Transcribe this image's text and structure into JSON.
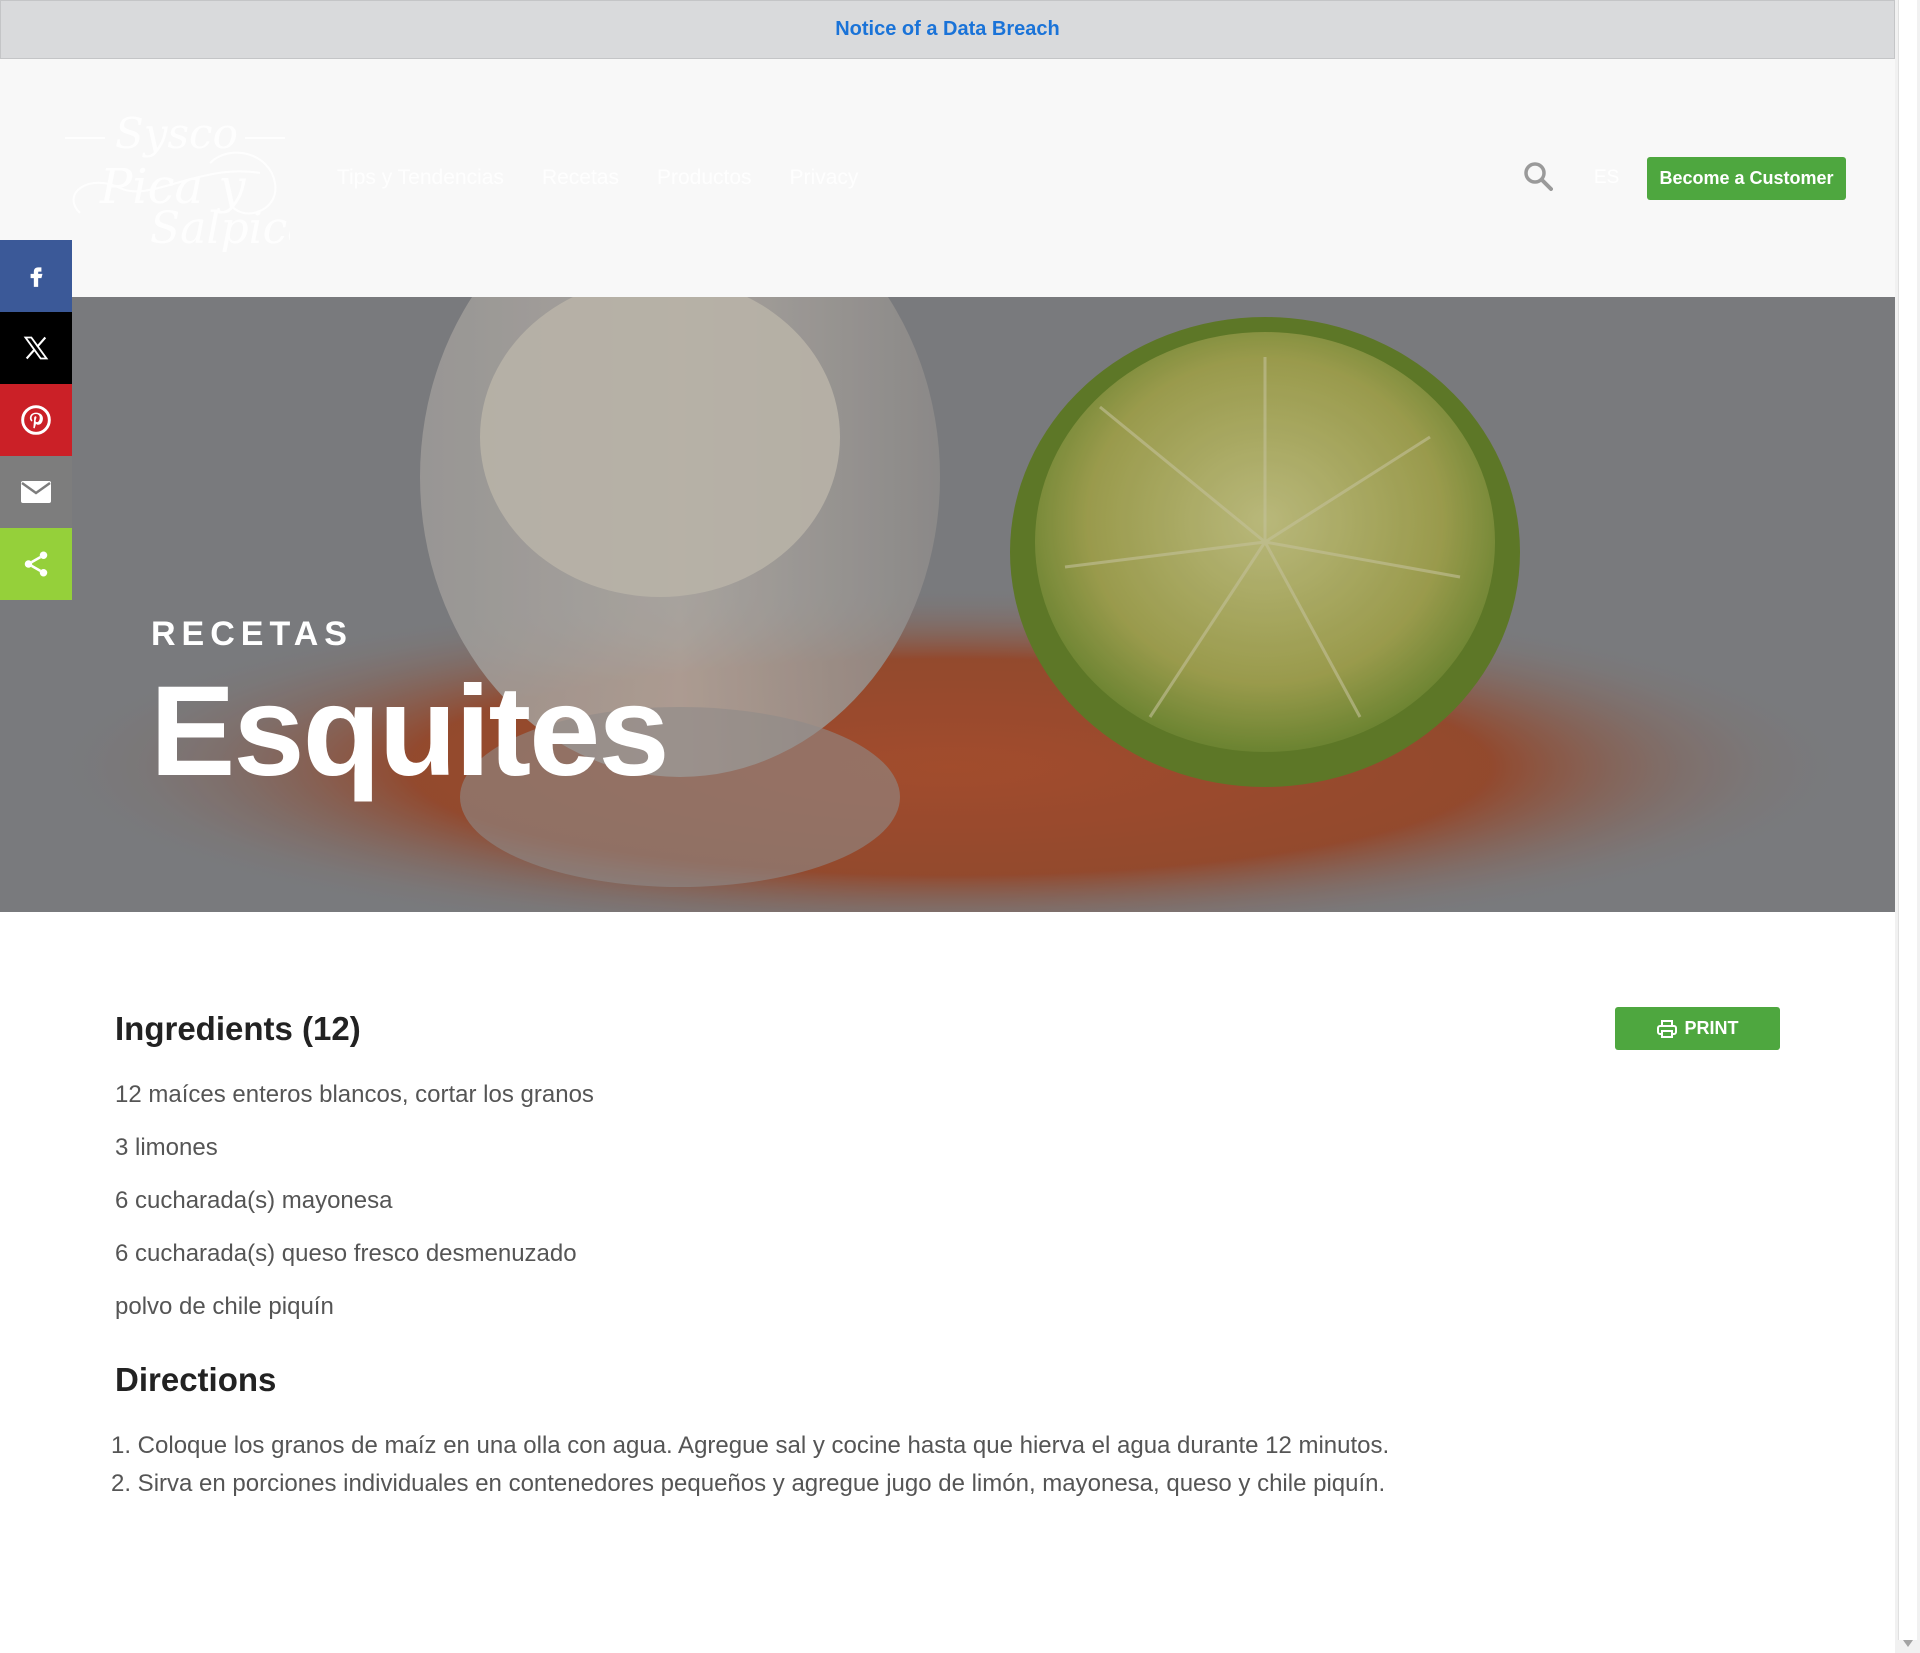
{
  "notice": {
    "label": "Notice of a Data Breach"
  },
  "header": {
    "logo_alt": "Sysco Pica y Salpica",
    "nav": [
      "Tips y Tendencias",
      "Recetas",
      "Productos",
      "Privacy"
    ],
    "lang": "ES",
    "cta_label": "Become a Customer"
  },
  "hero": {
    "kicker": "RECETAS",
    "title": "Esquites"
  },
  "share": [
    "facebook-icon",
    "x-icon",
    "pinterest-icon",
    "email-icon",
    "share-icon"
  ],
  "recipe": {
    "ingredients_title": "Ingredients (12)",
    "print_label": "PRINT",
    "ingredients": [
      "12 maíces enteros blancos, cortar los granos",
      "3 limones",
      "6 cucharada(s) mayonesa",
      "6 cucharada(s) queso fresco desmenuzado",
      "polvo de chile piquín"
    ],
    "directions_title": "Directions",
    "directions": [
      "1. Coloque los granos de maíz en una olla con agua. Agregue sal y cocine hasta que hierva el agua durante 12 minutos.",
      "2. Sirva en porciones individuales en contenedores pequeños y agregue jugo de limón, mayonesa, queso y chile piquín."
    ]
  },
  "colors": {
    "accent": "#4ea73f",
    "link": "#1a73d8",
    "facebook": "#3b5998",
    "pinterest": "#cb2027",
    "share": "#95d03a"
  }
}
